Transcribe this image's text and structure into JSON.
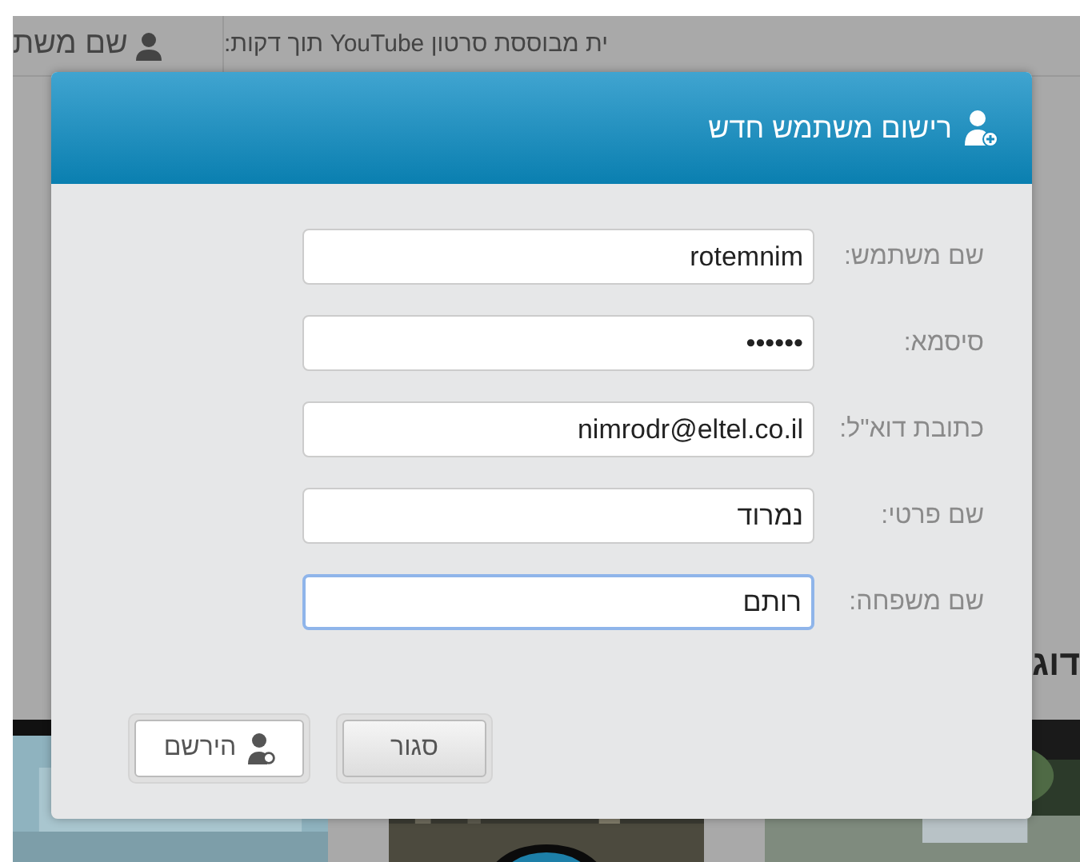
{
  "page": {
    "header_text": "ית מבוססת סרטון YouTube תוך דקות:",
    "user_label": "שם משת",
    "section_heading": "דוג"
  },
  "dialog": {
    "title": "רישום משתמש חדש",
    "fields": [
      {
        "label": "שם משתמש:",
        "value": "rotemnim",
        "focused": false
      },
      {
        "label": "סיסמא:",
        "value": "••••••",
        "focused": false
      },
      {
        "label": "כתובת דוא\"ל:",
        "value": "nimrodr@eltel.co.il",
        "focused": false
      },
      {
        "label": "שם פרטי:",
        "value": "נמרוד",
        "focused": false
      },
      {
        "label": "שם משפחה:",
        "value": "רותם",
        "focused": true
      }
    ],
    "buttons": [
      {
        "label": "סגור",
        "kind": "close"
      },
      {
        "label": "הירשם",
        "kind": "register"
      }
    ]
  }
}
